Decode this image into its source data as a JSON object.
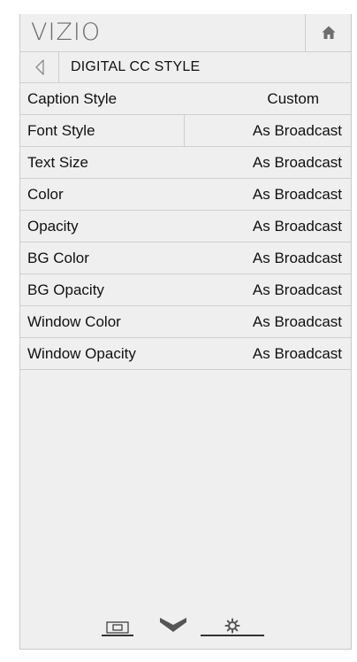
{
  "app": {
    "logo_text": "VIZIO"
  },
  "header": {
    "home_icon": "home-icon"
  },
  "breadcrumb": {
    "back_icon": "back-arrow-icon",
    "title": "DIGITAL CC STYLE"
  },
  "menu": {
    "items": [
      {
        "label": "Caption Style",
        "value": "Custom"
      },
      {
        "label": "Font Style",
        "value": "As Broadcast"
      },
      {
        "label": "Text Size",
        "value": "As Broadcast"
      },
      {
        "label": "Color",
        "value": "As Broadcast"
      },
      {
        "label": "Opacity",
        "value": "As Broadcast"
      },
      {
        "label": "BG Color",
        "value": "As Broadcast"
      },
      {
        "label": "BG Opacity",
        "value": "As Broadcast"
      },
      {
        "label": "Window Color",
        "value": "As Broadcast"
      },
      {
        "label": "Window Opacity",
        "value": "As Broadcast"
      }
    ]
  },
  "footer": {
    "icons": [
      "picture-icon",
      "chevron-down-icon",
      "settings-gear-icon"
    ]
  },
  "colors": {
    "panel_bg": "#efefef",
    "divider": "#cfcfcf",
    "text": "#111111",
    "logo": "#6b6b6b"
  }
}
